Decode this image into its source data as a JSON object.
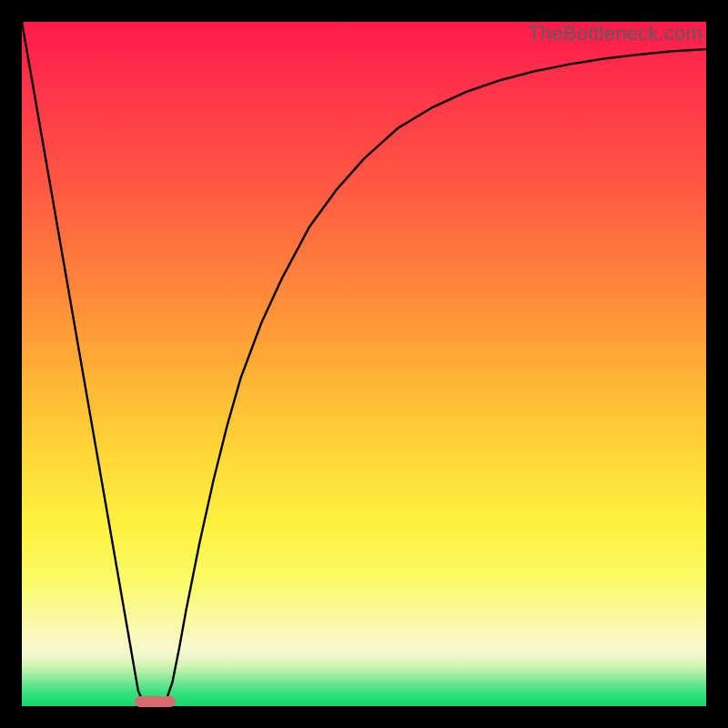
{
  "watermark": "TheBottleneck.com",
  "marker_color": "#d96b6e",
  "curve_stroke": "#000000",
  "chart_data": {
    "type": "line",
    "title": "",
    "xlabel": "",
    "ylabel": "",
    "xlim": [
      0,
      100
    ],
    "ylim": [
      0,
      100
    ],
    "grid": false,
    "legend": false,
    "series": [
      {
        "name": "bottleneck-curve",
        "x": [
          0,
          2,
          4,
          6,
          8,
          10,
          12,
          14,
          16,
          17,
          18,
          19,
          20,
          21,
          22,
          23,
          24,
          26,
          28,
          30,
          32,
          35,
          38,
          42,
          46,
          50,
          55,
          60,
          65,
          70,
          75,
          80,
          85,
          90,
          95,
          100
        ],
        "y": [
          100,
          88.5,
          77,
          65.5,
          54,
          42.5,
          31,
          19.5,
          8,
          2.25,
          0,
          0,
          0,
          0.6,
          3.5,
          8.5,
          14,
          24,
          33,
          41,
          48,
          56,
          62.5,
          70,
          75.5,
          80,
          84.5,
          87.5,
          89.8,
          91.5,
          92.8,
          93.8,
          94.6,
          95.2,
          95.7,
          96
        ]
      }
    ],
    "marker": {
      "name": "optimal-range",
      "x_start": 16.5,
      "x_end": 22.5,
      "y": 0
    },
    "background_gradient": {
      "top": "#ff1a4c",
      "mid_upper": "#ff8a3a",
      "mid": "#fdf23f",
      "mid_lower": "#faf9a9",
      "bottom": "#12d96a"
    }
  }
}
